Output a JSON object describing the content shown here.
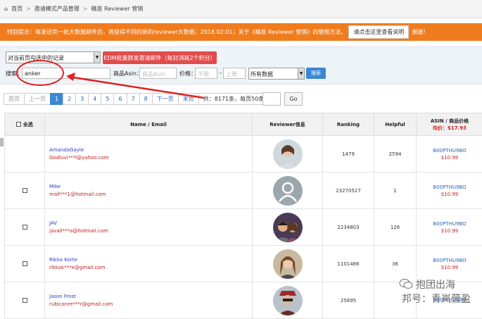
{
  "breadcrumb": {
    "home": "首页",
    "item2": "邀请模式产品管理",
    "item3": "精准 Reviewer 营销"
  },
  "notice": {
    "text": "特别提示：每发送完一批大数据邮件后，将获得不同的新的reviewer大数据；2018.02.01；关于《精准 Reviewer 营销》的使用方法，",
    "button": "请点击这里查看说明",
    "tail": "谢谢！"
  },
  "filter": {
    "select_records": "对当前页勾选中的记录",
    "edm_button": "EDM批量群发邀请邮件（每封消耗2个积分）",
    "search_label": "搜索：",
    "search_value": "anker",
    "asin_label": "商品Asin：",
    "asin_placeholder": "商品Asin",
    "price_label": "价格：",
    "price_low_placeholder": "下限",
    "price_dash": "-",
    "price_high_placeholder": "上限",
    "data_select": "所有数据",
    "search_button": "搜索"
  },
  "pager": {
    "first": "首页",
    "prev": "上一页",
    "pages": [
      "1",
      "2",
      "3",
      "4",
      "5",
      "6",
      "7",
      "8"
    ],
    "active_page": "1",
    "next": "下一页",
    "last": "末页",
    "info": "共：8171条，每页50条",
    "go": "Go"
  },
  "table": {
    "headers": {
      "select_all": "全选",
      "name": "Name / Email",
      "reviewer": "Reviewer信息",
      "ranking": "Ranking",
      "helpful": "Helpful",
      "asin": "ASIN / 商品价格",
      "avg_price": "均价：$17.93"
    },
    "rows": [
      {
        "name": "AmandaGayle",
        "email": "Godluvi***l@yahoo.com",
        "ranking": "1479",
        "helpful": "2594",
        "asin": "B00PTHU9BO",
        "price": "$10.99",
        "avatar": "woman-avatar"
      },
      {
        "name": "Mike",
        "email": "mall***1@hotmail.com",
        "ranking": "23270527",
        "helpful": "1",
        "asin": "B00PTHU9BO",
        "price": "$10.99",
        "avatar": "default-avatar"
      },
      {
        "name": "JAV",
        "email": "javall***a@hotmail.com",
        "ranking": "2234803",
        "helpful": "126",
        "asin": "B00PTHU9BO",
        "price": "$10.99",
        "avatar": "couple-avatar"
      },
      {
        "name": "Rikka Korte",
        "email": "rikkak***e@gmail.com",
        "ranking": "1101486",
        "helpful": "36",
        "asin": "B00PTHU9BO",
        "price": "$10.99",
        "avatar": "woman2-avatar"
      },
      {
        "name": "Jason Frost",
        "email": "rubiconre***r@gmail.com",
        "ranking": "25895",
        "helpful": "",
        "asin": "B00PTHU9BO",
        "price": "",
        "avatar": "man-avatar"
      }
    ]
  },
  "watermark": {
    "line1": "抱团出海",
    "line2": "邦号：青岚营盈"
  },
  "colors": {
    "notice_bg": "#f07c1e",
    "accent": "#3a87d6",
    "edm_red": "#e04c4c",
    "annotation_red": "#e02020"
  }
}
